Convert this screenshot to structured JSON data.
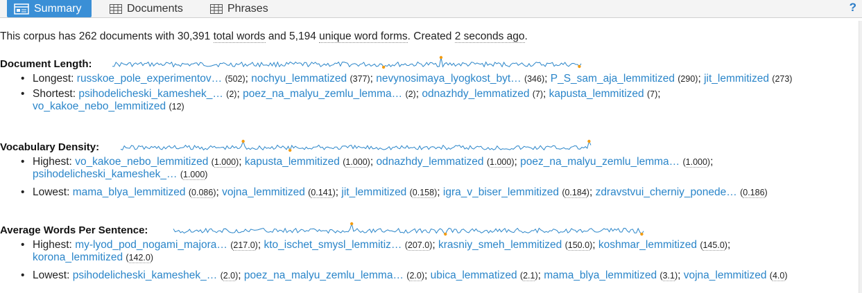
{
  "tabs": [
    {
      "label": "Summary",
      "active": true
    },
    {
      "label": "Documents",
      "active": false
    },
    {
      "label": "Phrases",
      "active": false
    }
  ],
  "help_label": "?",
  "summary": {
    "prefix": "This corpus has 262 documents with 30,391 ",
    "total_words_label": "total words",
    "middle": " and 5,194 ",
    "unique_label": "unique word forms",
    "created_prefix": ". Created ",
    "created_value": "2 seconds ago",
    "suffix": "."
  },
  "sections": {
    "length": {
      "title": "Document Length:",
      "rows": [
        {
          "label": "Longest:",
          "items": [
            {
              "name": "russkoe_pole_experimentov…",
              "count": "(502)"
            },
            {
              "name": "nochyu_lemmatized",
              "count": "(377)"
            },
            {
              "name": "nevynosimaya_lyogkost_byt…",
              "count": "(346)"
            },
            {
              "name": "P_S_sam_aja_lemmitized",
              "count": "(290)"
            },
            {
              "name": "jit_lemmitized",
              "count": "(273)"
            }
          ]
        },
        {
          "label": "Shortest:",
          "items": [
            {
              "name": "psihodelicheski_kameshek_…",
              "count": "(2)"
            },
            {
              "name": "poez_na_malyu_zemlu_lemma…",
              "count": "(2)"
            },
            {
              "name": "odnazhdy_lemmatized",
              "count": "(7)"
            },
            {
              "name": "kapusta_lemmitized",
              "count": "(7)"
            },
            {
              "name": "vo_kakoe_nebo_lemmitized",
              "count": "(12)"
            }
          ]
        }
      ]
    },
    "density": {
      "title": "Vocabulary Density:",
      "rows": [
        {
          "label": "Highest:",
          "items": [
            {
              "name": "vo_kakoe_nebo_lemmitized",
              "count": "1.000"
            },
            {
              "name": "kapusta_lemmitized",
              "count": "1.000"
            },
            {
              "name": "odnazhdy_lemmatized",
              "count": "1.000"
            },
            {
              "name": "poez_na_malyu_zemlu_lemma…",
              "count": "1.000"
            },
            {
              "name": "psihodelicheski_kameshek_…",
              "count": "1.000"
            }
          ]
        },
        {
          "label": "Lowest:",
          "items": [
            {
              "name": "mama_blya_lemmitized",
              "count": "0.086"
            },
            {
              "name": "vojna_lemmitized",
              "count": "0.141"
            },
            {
              "name": "jit_lemmitized",
              "count": "0.158"
            },
            {
              "name": "igra_v_biser_lemmitized",
              "count": "0.184"
            },
            {
              "name": "zdravstvui_cherniy_ponede…",
              "count": "0.186"
            }
          ]
        }
      ]
    },
    "sentence": {
      "title": "Average Words Per Sentence:",
      "rows": [
        {
          "label": "Highest:",
          "items": [
            {
              "name": "my-lyod_pod_nogami_majora…",
              "count": "217.0"
            },
            {
              "name": "kto_ischet_smysl_lemmitiz…",
              "count": "207.0"
            },
            {
              "name": "krasniy_smeh_lemmitized",
              "count": "150.0"
            },
            {
              "name": "koshmar_lemmitized",
              "count": "145.0"
            },
            {
              "name": "korona_lemmitized",
              "count": "142.0"
            }
          ]
        },
        {
          "label": "Lowest:",
          "items": [
            {
              "name": "psihodelicheski_kameshek_…",
              "count": "2.0"
            },
            {
              "name": "poez_na_malyu_zemlu_lemma…",
              "count": "2.0"
            },
            {
              "name": "ubica_lemmatized",
              "count": "2.1"
            },
            {
              "name": "mama_blya_lemmitized",
              "count": "3.1"
            },
            {
              "name": "vojna_lemmitized",
              "count": "4.0"
            }
          ]
        }
      ]
    }
  },
  "colors": {
    "accent": "#3a8fd6",
    "link": "#2a85c9",
    "sparkline": "#2a85c9",
    "marker": "#f39c12"
  }
}
